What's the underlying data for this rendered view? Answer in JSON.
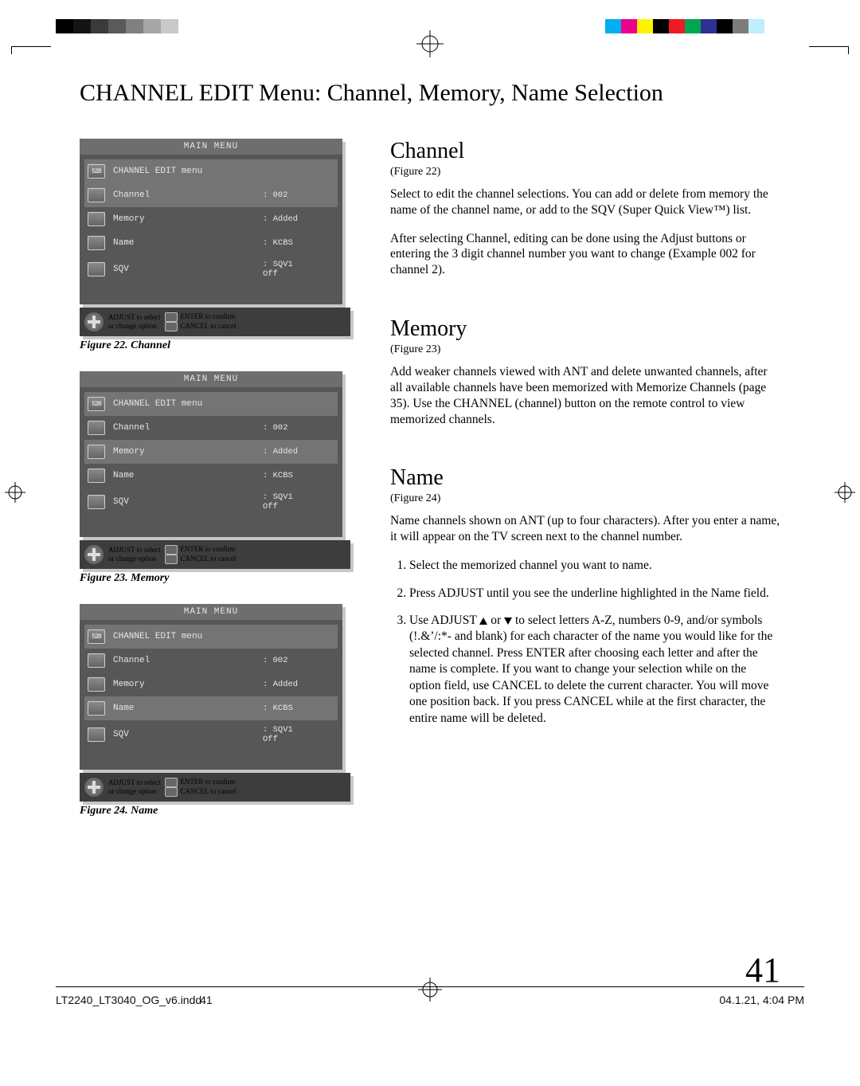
{
  "page": {
    "title": "CHANNEL EDIT Menu: Channel, Memory, Name Selection",
    "number": "41"
  },
  "menus": {
    "title": "MAIN MENU",
    "submenu": "CHANNEL EDIT menu",
    "rows": {
      "channel": {
        "label": "Channel",
        "value": ": 002"
      },
      "memory": {
        "label": "Memory",
        "value": ": Added"
      },
      "name": {
        "label": "Name",
        "value": ": KCBS"
      },
      "sqv": {
        "label": "SQV",
        "value1": ": SQV1",
        "value2": "Off"
      }
    },
    "variants": {
      "fig22": {
        "caption": "Figure 22.  Channel",
        "highlight": "channel"
      },
      "fig23": {
        "caption": "Figure 23.  Memory",
        "highlight": "memory"
      },
      "fig24": {
        "caption": "Figure 24.  Name",
        "highlight": "name"
      }
    },
    "footer": {
      "adjust": "ADJUST to select",
      "change": "or change option",
      "enter": "ENTER to confirm",
      "cancel": "CANCEL to cancel"
    }
  },
  "sections": {
    "channel": {
      "heading": "Channel",
      "sub": "(Figure 22)",
      "p1": "Select to edit the channel selections.  You can add or delete from memory the name of the channel name, or add to the SQV (Super Quick View™) list.",
      "p2": "After selecting Channel, editing can be done using the Adjust buttons or entering the 3 digit channel number you want to change (Example 002 for channel 2)."
    },
    "memory": {
      "heading": "Memory",
      "sub": "(Figure 23)",
      "p1": "Add weaker channels viewed with ANT and delete unwanted channels, after all available channels have been memorized with Memorize Channels (page 35). Use the CHANNEL (channel) button on the remote control to view memorized channels."
    },
    "name": {
      "heading": "Name",
      "sub": "(Figure 24)",
      "p1": "Name channels shown on ANT (up to four characters).  After you enter a name, it will appear on the TV screen next to the channel number.",
      "step1": "Select the memorized channel you want to name.",
      "step2": "Press ADJUST until you see the underline highlighted in the Name field.",
      "step3a": "Use ADJUST ",
      "step3b": " or ",
      "step3c": " to select letters A-Z, numbers 0-9, and/or symbols (!.&’/:*- and blank) for each character of the name you would like for the selected channel.  Press ENTER after choosing each letter and after the name is complete. If you want to change your selection while on the option field, use CANCEL to delete the current character. You will move one position back.  If you press CANCEL while at the first character, the entire name will be deleted."
    }
  },
  "printer": {
    "file": "LT2240_LT3040_OG_v6.indd",
    "filepg": "41",
    "stamp": "04.1.21, 4:04 PM"
  },
  "reg_colors": {
    "gray": [
      "#000000",
      "#141414",
      "#3a3a3a",
      "#5a5a5a",
      "#808080",
      "#a6a6a6",
      "#c9c9c9",
      "#ffffff"
    ],
    "cmyk": [
      "#00aeef",
      "#ec008c",
      "#fff200",
      "#000000",
      "#ed1c24",
      "#00a651",
      "#2e3192",
      "#000000",
      "#7d7d7d",
      "#bfeffc"
    ]
  }
}
